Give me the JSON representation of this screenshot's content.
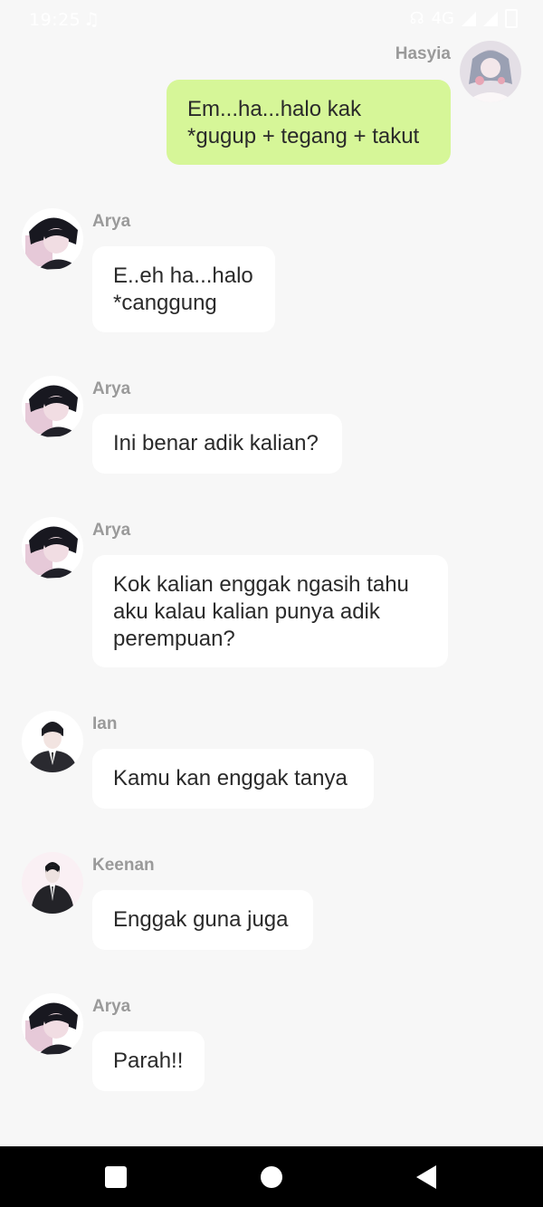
{
  "status_bar": {
    "time": "19:25",
    "network": "4G"
  },
  "messages": [
    {
      "sender": "Hasyia",
      "text": "Em...ha...halo kak\n*gugup + tegang + takut",
      "outgoing": true
    },
    {
      "sender": "Arya",
      "text": "E..eh ha...halo\n*canggung",
      "outgoing": false
    },
    {
      "sender": "Arya",
      "text": "Ini benar adik kalian?",
      "outgoing": false
    },
    {
      "sender": "Arya",
      "text": "Kok kalian enggak ngasih tahu\naku kalau kalian punya adik\nperempuan?",
      "outgoing": false
    },
    {
      "sender": "Ian",
      "text": "Kamu kan enggak tanya",
      "outgoing": false
    },
    {
      "sender": "Keenan",
      "text": "Enggak guna juga",
      "outgoing": false
    },
    {
      "sender": "Arya",
      "text": "Parah!!",
      "outgoing": false
    }
  ],
  "colors": {
    "background": "#f7f7f7",
    "outgoing_bubble": "#d6f698",
    "incoming_bubble": "#ffffff",
    "name_text": "#9a9a9a"
  }
}
